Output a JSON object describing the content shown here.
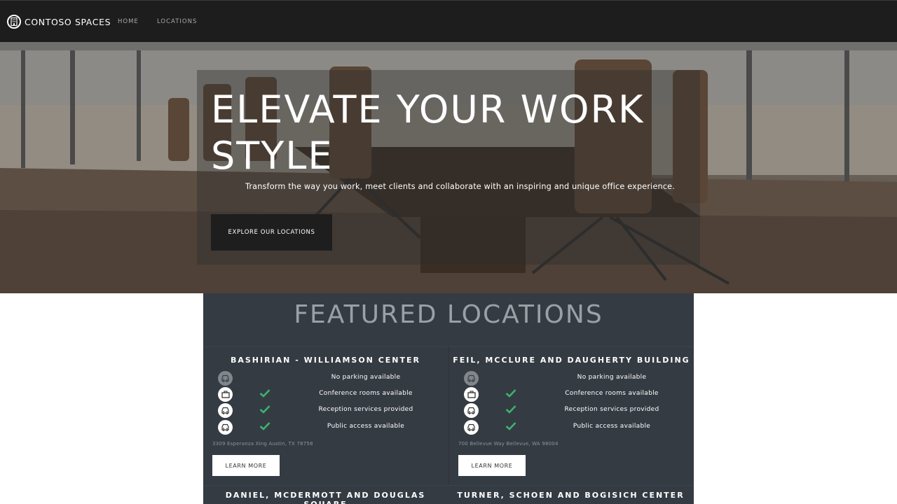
{
  "nav": {
    "brand": "CONTOSO SPACES",
    "brand_icon": "building-icon",
    "links": [
      {
        "label": "HOME"
      },
      {
        "label": "LOCATIONS"
      }
    ]
  },
  "hero": {
    "title": "ELEVATE YOUR WORK STYLE",
    "subtitle": "Transform the way you work, meet clients and collaborate with an inspiring and unique office experience.",
    "cta": "EXPLORE OUR LOCATIONS"
  },
  "featured": {
    "title": "FEATURED LOCATIONS",
    "locations": [
      {
        "name": "BASHIRIAN - WILLIAMSON CENTER",
        "amenities": [
          {
            "icon": "car-icon",
            "available": false,
            "label": "No parking available"
          },
          {
            "icon": "briefcase-icon",
            "available": true,
            "label": "Conference rooms available"
          },
          {
            "icon": "car-icon",
            "available": true,
            "label": "Reception services provided"
          },
          {
            "icon": "car-icon",
            "available": true,
            "label": "Public access available"
          }
        ],
        "address": "3309 Esperanza Xing Austin, TX 78758",
        "button": "LEARN MORE"
      },
      {
        "name": "FEIL, MCCLURE AND DAUGHERTY BUILDING",
        "amenities": [
          {
            "icon": "car-icon",
            "available": false,
            "label": "No parking available"
          },
          {
            "icon": "briefcase-icon",
            "available": true,
            "label": "Conference rooms available"
          },
          {
            "icon": "car-icon",
            "available": true,
            "label": "Reception services provided"
          },
          {
            "icon": "car-icon",
            "available": true,
            "label": "Public access available"
          }
        ],
        "address": "700 Bellevue Way Bellevue, WA 98004",
        "button": "LEARN MORE"
      },
      {
        "name": "DANIEL, MCDERMOTT AND DOUGLAS SQUARE"
      },
      {
        "name": "TURNER, SCHOEN AND BOGISICH CENTER"
      }
    ]
  },
  "colors": {
    "nav_bg": "#1d1d1d",
    "panel_bg": "#353b43",
    "check": "#3cb371"
  }
}
